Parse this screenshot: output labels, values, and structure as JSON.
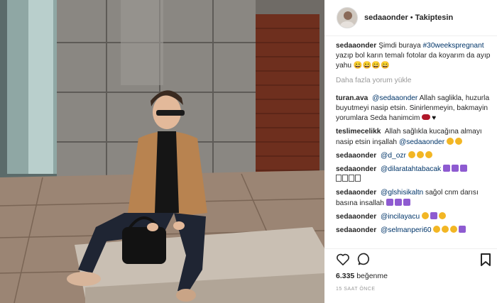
{
  "post": {
    "username": "sedaaonder",
    "separator": "•",
    "follow_state": "Takiptesin",
    "caption": {
      "user": "sedaaonder",
      "text_before": "Şimdi buraya",
      "hashtag": "#30weekspregnant",
      "text_after": "yazıp bol karın temalı fotolar da koyarım da ayıp yahu 😄😄😄😄"
    },
    "load_more": "Daha fazla yorum yükle",
    "comments": [
      {
        "user": "turan.ava",
        "mention": "@sedaaonder",
        "text": "Allah saglikla, huzurla buyutmeyi nasip etsin. Sinirlenmeyin, bakmayin yorumlara Seda hanimcim",
        "emoji": [
          "lips",
          "black-heart"
        ]
      },
      {
        "user": "teslimecelikk",
        "mention": "",
        "text": "Allah sağlıkla kucağına almayı nasip etsin inşallah",
        "mention_after": "@sedaaonder",
        "emoji": [
          "face",
          "face"
        ]
      },
      {
        "user": "sedaaonder",
        "mention": "@d_ozr",
        "text": "",
        "emoji": [
          "face",
          "face",
          "face"
        ]
      },
      {
        "user": "sedaaonder",
        "mention": "@dilaratahtabacak",
        "text": "",
        "emoji": [
          "heart",
          "heart",
          "heart"
        ],
        "trailing_boxes": 4
      },
      {
        "user": "sedaaonder",
        "mention": "@glshisikaltn",
        "text": "sağol cnm darısı basına insallah",
        "emoji": [
          "heart",
          "heart",
          "heart"
        ]
      },
      {
        "user": "sedaaonder",
        "mention": "@incilayacu",
        "text": "",
        "emoji": [
          "face",
          "heart",
          "face"
        ]
      },
      {
        "user": "sedaaonder",
        "mention": "@selmanperi60",
        "text": "",
        "emoji": [
          "face",
          "face",
          "face",
          "heart"
        ]
      }
    ],
    "likes_count": "6.335",
    "likes_label": "beğenme",
    "timestamp": "15 SAAT ÖNCE"
  },
  "icons": {
    "like": "heart-outline-icon",
    "comment": "comment-bubble-icon",
    "save": "bookmark-icon"
  },
  "colors": {
    "link": "#003569",
    "muted": "#999999",
    "text": "#262626"
  }
}
